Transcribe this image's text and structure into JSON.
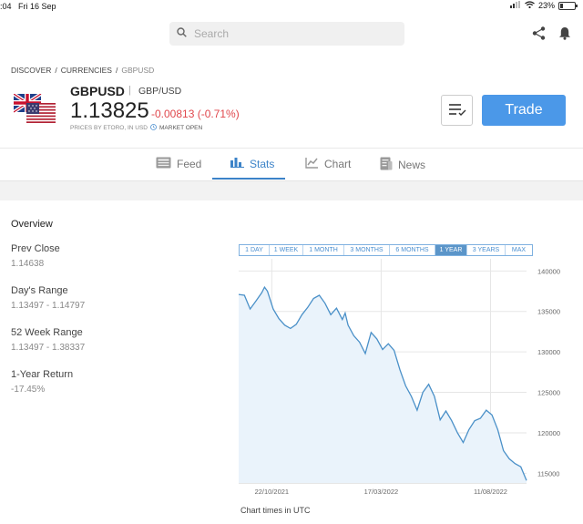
{
  "status": {
    "time": ":04",
    "date": "Fri 16 Sep",
    "battery": "23%",
    "battery_level": 0.23
  },
  "search": {
    "placeholder": "Search"
  },
  "breadcrumb": {
    "discover": "DISCOVER",
    "currencies": "CURRENCIES",
    "current": "GBPUSD",
    "sep": "/"
  },
  "instrument": {
    "symbol": "GBPUSD",
    "separator": "|",
    "pair": "GBP/USD",
    "price": "1.13825",
    "change": "-0.00813 (-0.71%)",
    "priced_by": "PRICES BY ETORO, IN USD",
    "market_status": "MARKET OPEN"
  },
  "actions": {
    "trade": "Trade"
  },
  "tabs": [
    {
      "label": "Feed",
      "icon": "feed-icon"
    },
    {
      "label": "Stats",
      "icon": "stats-icon",
      "active": true
    },
    {
      "label": "Chart",
      "icon": "chart-icon"
    },
    {
      "label": "News",
      "icon": "news-icon"
    }
  ],
  "overview": {
    "title": "Overview",
    "stats": [
      {
        "label": "Prev Close",
        "value": "1.14638"
      },
      {
        "label": "Day's Range",
        "value": "1.13497 - 1.14797"
      },
      {
        "label": "52 Week Range",
        "value": "1.13497 - 1.38337"
      },
      {
        "label": "1-Year Return",
        "value": "-17.45%"
      }
    ]
  },
  "ranges": [
    "1 DAY",
    "1 WEEK",
    "1 MONTH",
    "3 MONTHS",
    "6 MONTHS",
    "1 YEAR",
    "3 YEARS",
    "MAX"
  ],
  "selected_range": "1 YEAR",
  "chart_note": "Chart times in UTC",
  "colors": {
    "accent": "#3c83c8",
    "trade_button": "#4b98e8",
    "negative": "#e0474c",
    "chart_line": "#4a90c8",
    "chart_fill": "#eaf3fb"
  },
  "chart_data": {
    "type": "area",
    "y_tick_labels": [
      "140000",
      "135000",
      "130000",
      "125000",
      "120000",
      "115000"
    ],
    "y_ticks": [
      140000,
      135000,
      130000,
      125000,
      120000,
      115000
    ],
    "ylim": [
      113800,
      141500
    ],
    "x_tick_labels": [
      "22/10/2021",
      "17/03/2022",
      "11/08/2022"
    ],
    "x_ticks": [
      0.115,
      0.495,
      0.875
    ],
    "series": [
      {
        "x": [
          0,
          0.02,
          0.04,
          0.06,
          0.08,
          0.09,
          0.1,
          0.12,
          0.14,
          0.16,
          0.18,
          0.2,
          0.22,
          0.24,
          0.26,
          0.28,
          0.3,
          0.32,
          0.34,
          0.36,
          0.37,
          0.38,
          0.4,
          0.42,
          0.44,
          0.46,
          0.48,
          0.5,
          0.52,
          0.54,
          0.56,
          0.58,
          0.6,
          0.62,
          0.64,
          0.66,
          0.68,
          0.7,
          0.72,
          0.74,
          0.76,
          0.78,
          0.8,
          0.82,
          0.84,
          0.86,
          0.88,
          0.9,
          0.92,
          0.94,
          0.96,
          0.98,
          1.0
        ],
        "values": [
          137100,
          137000,
          135300,
          136300,
          137300,
          138000,
          137500,
          135300,
          134100,
          133300,
          132900,
          133400,
          134600,
          135500,
          136600,
          137000,
          136000,
          134600,
          135400,
          134000,
          134800,
          133300,
          132000,
          131200,
          129800,
          132400,
          131600,
          130300,
          131000,
          130200,
          127800,
          125800,
          124500,
          122800,
          125000,
          126000,
          124500,
          121600,
          122700,
          121500,
          120000,
          118800,
          120400,
          121500,
          121800,
          122800,
          122200,
          120400,
          117800,
          116800,
          116200,
          115800,
          114100
        ]
      }
    ]
  }
}
